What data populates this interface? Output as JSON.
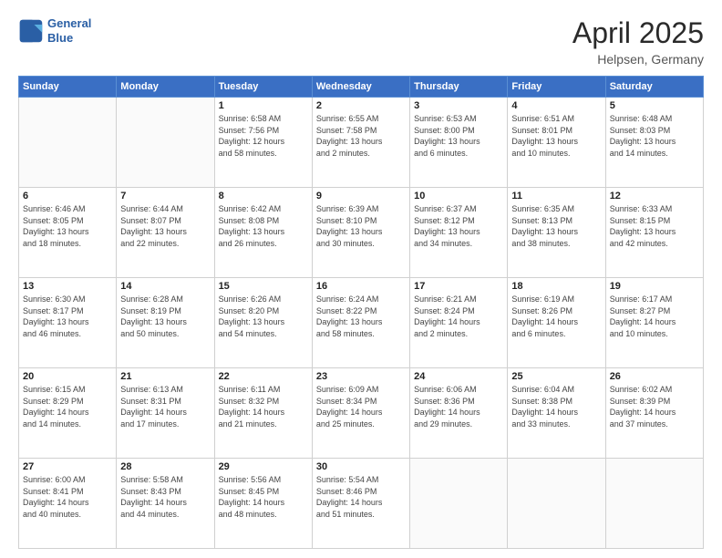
{
  "header": {
    "logo_line1": "General",
    "logo_line2": "Blue",
    "month": "April 2025",
    "location": "Helpsen, Germany"
  },
  "weekdays": [
    "Sunday",
    "Monday",
    "Tuesday",
    "Wednesday",
    "Thursday",
    "Friday",
    "Saturday"
  ],
  "weeks": [
    [
      {
        "day": "",
        "info": ""
      },
      {
        "day": "",
        "info": ""
      },
      {
        "day": "1",
        "info": "Sunrise: 6:58 AM\nSunset: 7:56 PM\nDaylight: 12 hours\nand 58 minutes."
      },
      {
        "day": "2",
        "info": "Sunrise: 6:55 AM\nSunset: 7:58 PM\nDaylight: 13 hours\nand 2 minutes."
      },
      {
        "day": "3",
        "info": "Sunrise: 6:53 AM\nSunset: 8:00 PM\nDaylight: 13 hours\nand 6 minutes."
      },
      {
        "day": "4",
        "info": "Sunrise: 6:51 AM\nSunset: 8:01 PM\nDaylight: 13 hours\nand 10 minutes."
      },
      {
        "day": "5",
        "info": "Sunrise: 6:48 AM\nSunset: 8:03 PM\nDaylight: 13 hours\nand 14 minutes."
      }
    ],
    [
      {
        "day": "6",
        "info": "Sunrise: 6:46 AM\nSunset: 8:05 PM\nDaylight: 13 hours\nand 18 minutes."
      },
      {
        "day": "7",
        "info": "Sunrise: 6:44 AM\nSunset: 8:07 PM\nDaylight: 13 hours\nand 22 minutes."
      },
      {
        "day": "8",
        "info": "Sunrise: 6:42 AM\nSunset: 8:08 PM\nDaylight: 13 hours\nand 26 minutes."
      },
      {
        "day": "9",
        "info": "Sunrise: 6:39 AM\nSunset: 8:10 PM\nDaylight: 13 hours\nand 30 minutes."
      },
      {
        "day": "10",
        "info": "Sunrise: 6:37 AM\nSunset: 8:12 PM\nDaylight: 13 hours\nand 34 minutes."
      },
      {
        "day": "11",
        "info": "Sunrise: 6:35 AM\nSunset: 8:13 PM\nDaylight: 13 hours\nand 38 minutes."
      },
      {
        "day": "12",
        "info": "Sunrise: 6:33 AM\nSunset: 8:15 PM\nDaylight: 13 hours\nand 42 minutes."
      }
    ],
    [
      {
        "day": "13",
        "info": "Sunrise: 6:30 AM\nSunset: 8:17 PM\nDaylight: 13 hours\nand 46 minutes."
      },
      {
        "day": "14",
        "info": "Sunrise: 6:28 AM\nSunset: 8:19 PM\nDaylight: 13 hours\nand 50 minutes."
      },
      {
        "day": "15",
        "info": "Sunrise: 6:26 AM\nSunset: 8:20 PM\nDaylight: 13 hours\nand 54 minutes."
      },
      {
        "day": "16",
        "info": "Sunrise: 6:24 AM\nSunset: 8:22 PM\nDaylight: 13 hours\nand 58 minutes."
      },
      {
        "day": "17",
        "info": "Sunrise: 6:21 AM\nSunset: 8:24 PM\nDaylight: 14 hours\nand 2 minutes."
      },
      {
        "day": "18",
        "info": "Sunrise: 6:19 AM\nSunset: 8:26 PM\nDaylight: 14 hours\nand 6 minutes."
      },
      {
        "day": "19",
        "info": "Sunrise: 6:17 AM\nSunset: 8:27 PM\nDaylight: 14 hours\nand 10 minutes."
      }
    ],
    [
      {
        "day": "20",
        "info": "Sunrise: 6:15 AM\nSunset: 8:29 PM\nDaylight: 14 hours\nand 14 minutes."
      },
      {
        "day": "21",
        "info": "Sunrise: 6:13 AM\nSunset: 8:31 PM\nDaylight: 14 hours\nand 17 minutes."
      },
      {
        "day": "22",
        "info": "Sunrise: 6:11 AM\nSunset: 8:32 PM\nDaylight: 14 hours\nand 21 minutes."
      },
      {
        "day": "23",
        "info": "Sunrise: 6:09 AM\nSunset: 8:34 PM\nDaylight: 14 hours\nand 25 minutes."
      },
      {
        "day": "24",
        "info": "Sunrise: 6:06 AM\nSunset: 8:36 PM\nDaylight: 14 hours\nand 29 minutes."
      },
      {
        "day": "25",
        "info": "Sunrise: 6:04 AM\nSunset: 8:38 PM\nDaylight: 14 hours\nand 33 minutes."
      },
      {
        "day": "26",
        "info": "Sunrise: 6:02 AM\nSunset: 8:39 PM\nDaylight: 14 hours\nand 37 minutes."
      }
    ],
    [
      {
        "day": "27",
        "info": "Sunrise: 6:00 AM\nSunset: 8:41 PM\nDaylight: 14 hours\nand 40 minutes."
      },
      {
        "day": "28",
        "info": "Sunrise: 5:58 AM\nSunset: 8:43 PM\nDaylight: 14 hours\nand 44 minutes."
      },
      {
        "day": "29",
        "info": "Sunrise: 5:56 AM\nSunset: 8:45 PM\nDaylight: 14 hours\nand 48 minutes."
      },
      {
        "day": "30",
        "info": "Sunrise: 5:54 AM\nSunset: 8:46 PM\nDaylight: 14 hours\nand 51 minutes."
      },
      {
        "day": "",
        "info": ""
      },
      {
        "day": "",
        "info": ""
      },
      {
        "day": "",
        "info": ""
      }
    ]
  ]
}
